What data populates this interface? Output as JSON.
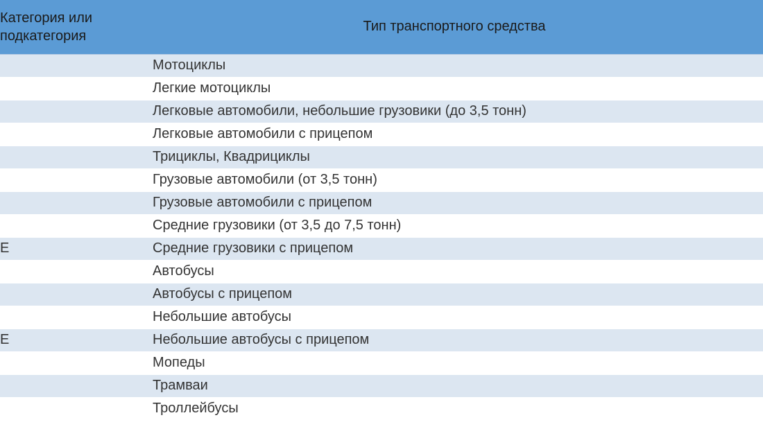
{
  "table": {
    "headers": {
      "category_line1": "Категория или",
      "category_line2": "подкатегория",
      "type": "Тип транспортного средства"
    },
    "rows": [
      {
        "category": "",
        "type": "Мотоциклы"
      },
      {
        "category": "",
        "type": "Легкие мотоциклы"
      },
      {
        "category": "",
        "type": "Легковые автомобили, небольшие грузовики (до 3,5 тонн)"
      },
      {
        "category": "",
        "type": "Легковые автомобили с прицепом"
      },
      {
        "category": "",
        "type": "Трициклы, Квадрициклы"
      },
      {
        "category": "",
        "type": "Грузовые автомобили (от 3,5 тонн)"
      },
      {
        "category": "",
        "type": "Грузовые автомобили с прицепом"
      },
      {
        "category": "",
        "type": "Средние грузовики (от 3,5 до 7,5 тонн)"
      },
      {
        "category": "E",
        "type": "Средние грузовики с прицепом"
      },
      {
        "category": "",
        "type": "Автобусы"
      },
      {
        "category": "",
        "type": "Автобусы с прицепом"
      },
      {
        "category": "",
        "type": "Небольшие автобусы"
      },
      {
        "category": "E",
        "type": "Небольшие автобусы с прицепом"
      },
      {
        "category": "",
        "type": "Мопеды"
      },
      {
        "category": "",
        "type": "Трамваи"
      },
      {
        "category": "",
        "type": "Троллейбусы"
      }
    ]
  }
}
